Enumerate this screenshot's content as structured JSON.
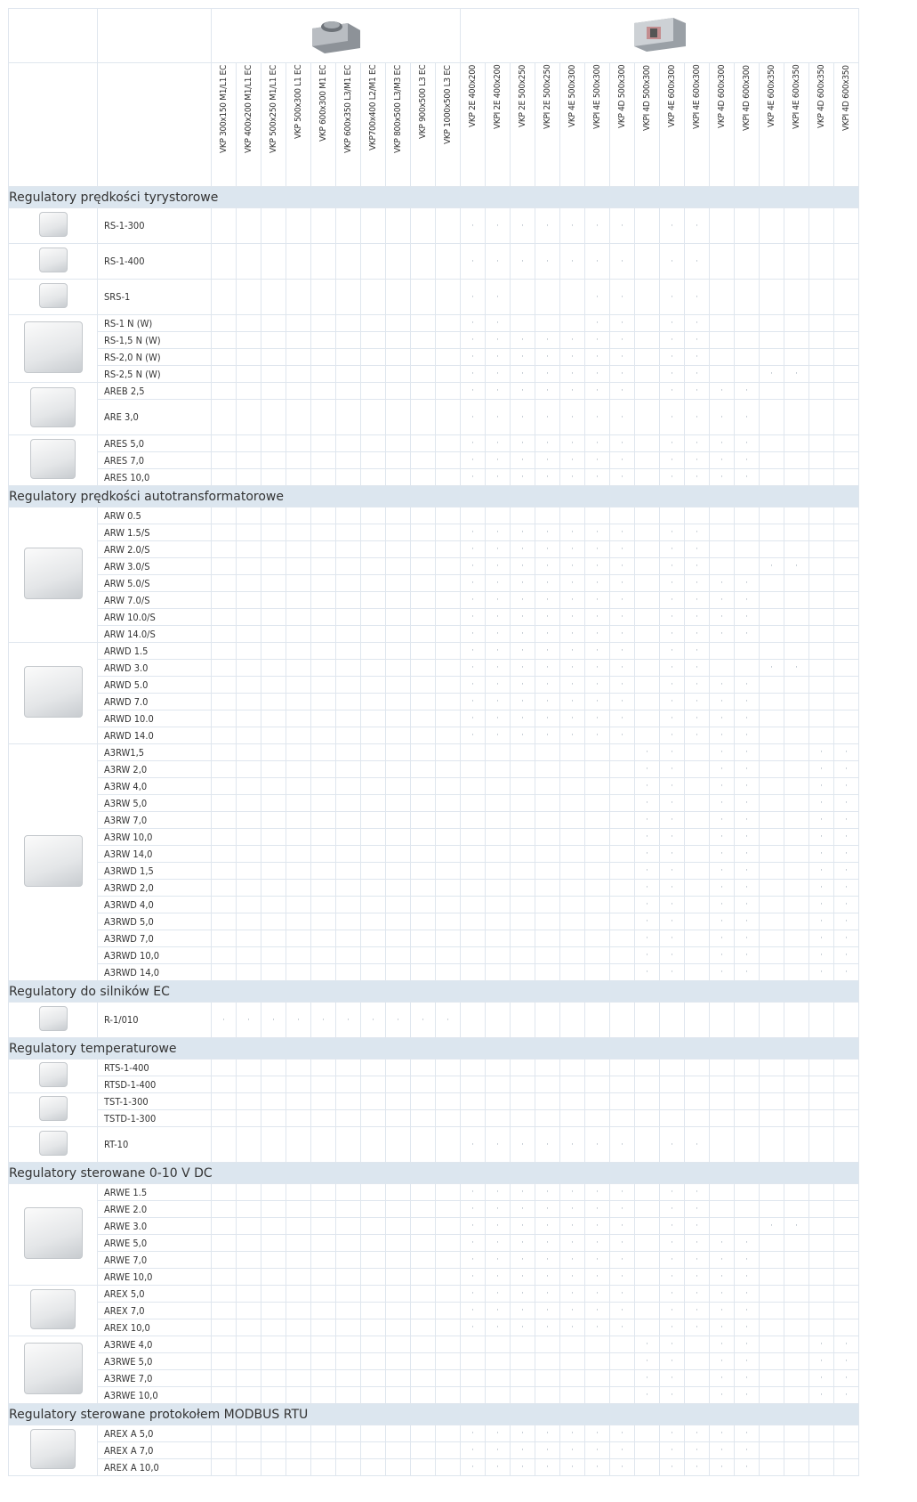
{
  "group_icons": [
    "duct-fan-ec-icon",
    "duct-fan-box-icon"
  ],
  "models": [
    "VKP 300x150 M1/L1 EC",
    "VKP 400x200 M1/L1 EC",
    "VKP 500x250 M1/L1 EC",
    "VKP 500x300 L1 EC",
    "VKP 600x300 M1 EC",
    "VKP 600x350 L3/M1 EC",
    "VKP700x400 L2/M1 EC",
    "VKP 800x500 L3/M3 EC",
    "VKP 900x500 L3 EC",
    "VKP 1000x500 L3 EC",
    "VKP 2E 400x200",
    "VKPI 2E 400x200",
    "VKP 2E 500x250",
    "VKPI 2E 500x250",
    "VKP 4E 500x300",
    "VKPI 4E 500x300",
    "VKP 4D 500x300",
    "VKPI 4D 500x300",
    "VKP 4E 600x300",
    "VKPI 4E 600x300",
    "VKP 4D 600x300",
    "VKPI 4D 600x300",
    "VKP 4E 600x350",
    "VKPI 4E 600x350",
    "VKP 4D 600x350",
    "VKPI 4D 600x350"
  ],
  "sections": [
    {
      "title": "Regulatory prędkości tyrystorowe",
      "groups": [
        {
          "icon": "speed-knob-icon",
          "tall": 2,
          "products": [
            {
              "name": "RS-1-300",
              "marks": [
                10,
                11,
                12,
                13,
                14,
                15,
                16,
                18,
                19
              ]
            }
          ]
        },
        {
          "icon": "speed-knob-icon",
          "tall": 2,
          "products": [
            {
              "name": "RS-1-400",
              "marks": [
                10,
                11,
                12,
                13,
                14,
                15,
                16,
                18,
                19
              ]
            }
          ]
        },
        {
          "icon": "wall-controller-icon",
          "tall": 2,
          "products": [
            {
              "name": "SRS-1",
              "marks": [
                10,
                11,
                15,
                16,
                18,
                19
              ]
            }
          ]
        },
        {
          "icon": "box-controller-icon",
          "products": [
            {
              "name": "RS-1 N (W)",
              "marks": [
                10,
                11,
                15,
                16,
                18,
                19
              ]
            },
            {
              "name": "RS-1,5 N (W)",
              "marks": [
                10,
                11,
                12,
                13,
                14,
                15,
                16,
                18,
                19
              ]
            },
            {
              "name": "RS-2,0 N (W)",
              "marks": [
                10,
                11,
                12,
                13,
                14,
                15,
                16,
                18,
                19
              ]
            },
            {
              "name": "RS-2,5 N (W)",
              "marks": [
                10,
                11,
                12,
                13,
                14,
                15,
                16,
                18,
                19,
                22,
                23
              ]
            }
          ]
        },
        {
          "icon": "cube-controller-icon",
          "products": [
            {
              "name": "AREB 2,5",
              "marks": [
                10,
                11,
                12,
                13,
                14,
                15,
                16,
                18,
                19,
                20,
                21
              ]
            },
            {
              "name": "ARE 3,0",
              "tall": 2,
              "marks": [
                10,
                11,
                12,
                13,
                14,
                15,
                16,
                18,
                19,
                20,
                21
              ]
            }
          ]
        },
        {
          "icon": "display-controller-icon",
          "products": [
            {
              "name": "ARES 5,0",
              "marks": [
                10,
                11,
                12,
                13,
                14,
                15,
                16,
                18,
                19,
                20,
                21
              ]
            },
            {
              "name": "ARES 7,0",
              "marks": [
                10,
                11,
                12,
                13,
                14,
                15,
                16,
                18,
                19,
                20,
                21
              ]
            },
            {
              "name": "ARES 10,0",
              "marks": [
                10,
                11,
                12,
                13,
                14,
                15,
                16,
                18,
                19,
                20,
                21
              ]
            }
          ]
        }
      ]
    },
    {
      "title": "Regulatory prędkości autotransformatorowe",
      "groups": [
        {
          "icon": "autotransformer-icon",
          "products": [
            {
              "name": "ARW 0.5",
              "marks": []
            },
            {
              "name": "ARW 1.5/S",
              "marks": [
                10,
                11,
                12,
                13,
                14,
                15,
                16,
                18,
                19
              ]
            },
            {
              "name": "ARW 2.0/S",
              "marks": [
                10,
                11,
                12,
                13,
                14,
                15,
                16,
                18,
                19
              ]
            },
            {
              "name": "ARW 3.0/S",
              "marks": [
                10,
                11,
                12,
                13,
                14,
                15,
                16,
                18,
                19,
                22,
                23
              ]
            },
            {
              "name": "ARW 5.0/S",
              "marks": [
                10,
                11,
                12,
                13,
                14,
                15,
                16,
                18,
                19,
                20,
                21
              ]
            },
            {
              "name": "ARW 7.0/S",
              "marks": [
                10,
                11,
                12,
                13,
                14,
                15,
                16,
                18,
                19,
                20,
                21
              ]
            },
            {
              "name": "ARW 10.0/S",
              "marks": [
                10,
                11,
                12,
                13,
                14,
                15,
                16,
                18,
                19,
                20,
                21
              ]
            },
            {
              "name": "ARW 14.0/S",
              "marks": [
                10,
                11,
                12,
                13,
                14,
                15,
                16,
                18,
                19,
                20,
                21
              ]
            }
          ]
        },
        {
          "icon": "autotransformer-d-icon",
          "products": [
            {
              "name": "ARWD 1.5",
              "marks": [
                10,
                11,
                12,
                13,
                14,
                15,
                16,
                18,
                19
              ]
            },
            {
              "name": "ARWD 3.0",
              "marks": [
                10,
                11,
                12,
                13,
                14,
                15,
                16,
                18,
                19,
                22,
                23
              ]
            },
            {
              "name": "ARWD 5.0",
              "marks": [
                10,
                11,
                12,
                13,
                14,
                15,
                16,
                18,
                19,
                20,
                21
              ]
            },
            {
              "name": "ARWD 7.0",
              "marks": [
                10,
                11,
                12,
                13,
                14,
                15,
                16,
                18,
                19,
                20,
                21
              ]
            },
            {
              "name": "ARWD 10.0",
              "marks": [
                10,
                11,
                12,
                13,
                14,
                15,
                16,
                18,
                19,
                20,
                21
              ]
            },
            {
              "name": "ARWD 14.0",
              "marks": [
                10,
                11,
                12,
                13,
                14,
                15,
                16,
                18,
                19,
                20,
                21
              ]
            }
          ]
        },
        {
          "icon": "three-phase-controller-icon",
          "products": [
            {
              "name": "A3RW1,5",
              "marks": [
                17,
                18,
                20,
                21,
                24,
                25
              ]
            },
            {
              "name": "A3RW 2,0",
              "marks": [
                17,
                18,
                20,
                21,
                24,
                25
              ]
            },
            {
              "name": "A3RW 4,0",
              "marks": [
                17,
                18,
                20,
                21,
                24,
                25
              ]
            },
            {
              "name": "A3RW 5,0",
              "marks": [
                17,
                18,
                20,
                21,
                24,
                25
              ]
            },
            {
              "name": "A3RW 7,0",
              "marks": [
                17,
                18,
                20,
                21,
                24,
                25
              ]
            },
            {
              "name": "A3RW 10,0",
              "marks": [
                17,
                18,
                20,
                21,
                24,
                25
              ]
            },
            {
              "name": "A3RW 14,0",
              "marks": [
                17,
                18,
                20,
                21,
                24,
                25
              ]
            },
            {
              "name": "A3RWD 1,5",
              "marks": [
                17,
                18,
                20,
                21,
                24,
                25
              ]
            },
            {
              "name": "A3RWD 2,0",
              "marks": [
                17,
                18,
                20,
                21,
                24,
                25
              ]
            },
            {
              "name": "A3RWD 4,0",
              "marks": [
                17,
                18,
                20,
                21,
                24,
                25
              ]
            },
            {
              "name": "A3RWD 5,0",
              "marks": [
                17,
                18,
                20,
                21,
                24,
                25
              ]
            },
            {
              "name": "A3RWD 7,0",
              "marks": [
                17,
                18,
                20,
                21,
                24,
                25
              ]
            },
            {
              "name": "A3RWD 10,0",
              "marks": [
                17,
                18,
                20,
                21,
                24,
                25
              ]
            },
            {
              "name": "A3RWD 14,0",
              "marks": [
                17,
                18,
                20,
                21,
                24,
                25
              ]
            }
          ]
        }
      ]
    },
    {
      "title": "Regulatory do silników EC",
      "groups": [
        {
          "icon": "ec-knob-icon",
          "tall": 2,
          "products": [
            {
              "name": "R-1/010",
              "marks": [
                0,
                1,
                2,
                3,
                4,
                5,
                6,
                7,
                8,
                9
              ]
            }
          ]
        }
      ]
    },
    {
      "title": "Regulatory temperaturowe",
      "groups": [
        {
          "icon": "thermostat-remote-icon",
          "products": [
            {
              "name": "RTS-1-400",
              "marks": []
            },
            {
              "name": "RTSD-1-400",
              "marks": []
            }
          ]
        },
        {
          "icon": "thermostat-display-icon",
          "products": [
            {
              "name": "TST-1-300",
              "marks": []
            },
            {
              "name": "TSTD-1-300",
              "marks": []
            }
          ]
        },
        {
          "icon": "room-thermostat-icon",
          "tall": 2,
          "products": [
            {
              "name": "RT-10",
              "marks": [
                10,
                11,
                12,
                13,
                14,
                15,
                16,
                18,
                19
              ]
            }
          ]
        }
      ]
    },
    {
      "title": "Regulatory sterowane 0-10 V DC",
      "groups": [
        {
          "icon": "arwe-controller-icon",
          "products": [
            {
              "name": "ARWE 1.5",
              "marks": [
                10,
                11,
                12,
                13,
                14,
                15,
                16,
                18,
                19
              ]
            },
            {
              "name": "ARWE 2.0",
              "marks": [
                10,
                11,
                12,
                13,
                14,
                15,
                16,
                18,
                19
              ]
            },
            {
              "name": "ARWE 3.0",
              "marks": [
                10,
                11,
                12,
                13,
                14,
                15,
                16,
                18,
                19,
                22,
                23
              ]
            },
            {
              "name": "ARWE 5,0",
              "marks": [
                10,
                11,
                12,
                13,
                14,
                15,
                16,
                18,
                19,
                20,
                21
              ]
            },
            {
              "name": "ARWE 7,0",
              "marks": [
                10,
                11,
                12,
                13,
                14,
                15,
                16,
                18,
                19,
                20,
                21
              ]
            },
            {
              "name": "ARWE 10,0",
              "marks": [
                10,
                11,
                12,
                13,
                14,
                15,
                16,
                18,
                19,
                20,
                21
              ]
            }
          ]
        },
        {
          "icon": "arex-controller-icon",
          "products": [
            {
              "name": "AREX 5,0",
              "marks": [
                10,
                11,
                12,
                13,
                14,
                15,
                16,
                18,
                19,
                20,
                21
              ]
            },
            {
              "name": "AREX 7,0",
              "marks": [
                10,
                11,
                12,
                13,
                14,
                15,
                16,
                18,
                19,
                20,
                21
              ]
            },
            {
              "name": "AREX 10,0",
              "marks": [
                10,
                11,
                12,
                13,
                14,
                15,
                16,
                18,
                19,
                20,
                21
              ]
            }
          ]
        },
        {
          "icon": "three-phase-0-10v-icon",
          "products": [
            {
              "name": "A3RWE 4,0",
              "marks": [
                17,
                18,
                20,
                21,
                24,
                25
              ]
            },
            {
              "name": "A3RWE 5,0",
              "marks": [
                17,
                18,
                20,
                21,
                24,
                25
              ]
            },
            {
              "name": "A3RWE 7,0",
              "marks": [
                17,
                18,
                20,
                21,
                24,
                25
              ]
            },
            {
              "name": "A3RWE 10,0",
              "marks": [
                17,
                18,
                20,
                21,
                24,
                25
              ]
            }
          ]
        }
      ]
    },
    {
      "title": "Regulatory sterowane protokołem MODBUS RTU",
      "groups": [
        {
          "icon": "modbus-controller-icon",
          "products": [
            {
              "name": "AREX A 5,0",
              "marks": [
                10,
                11,
                12,
                13,
                14,
                15,
                16,
                18,
                19,
                20,
                21
              ]
            },
            {
              "name": "AREX A 7,0",
              "marks": [
                10,
                11,
                12,
                13,
                14,
                15,
                16,
                18,
                19,
                20,
                21
              ]
            },
            {
              "name": "AREX A 10,0",
              "marks": [
                10,
                11,
                12,
                13,
                14,
                15,
                16,
                18,
                19,
                20,
                21
              ]
            }
          ]
        }
      ]
    }
  ],
  "mark_symbol": "·",
  "colors": {
    "section_bg": "#dce6ef",
    "grid": "#dfe6ee",
    "mark": "#9aa6b2"
  }
}
